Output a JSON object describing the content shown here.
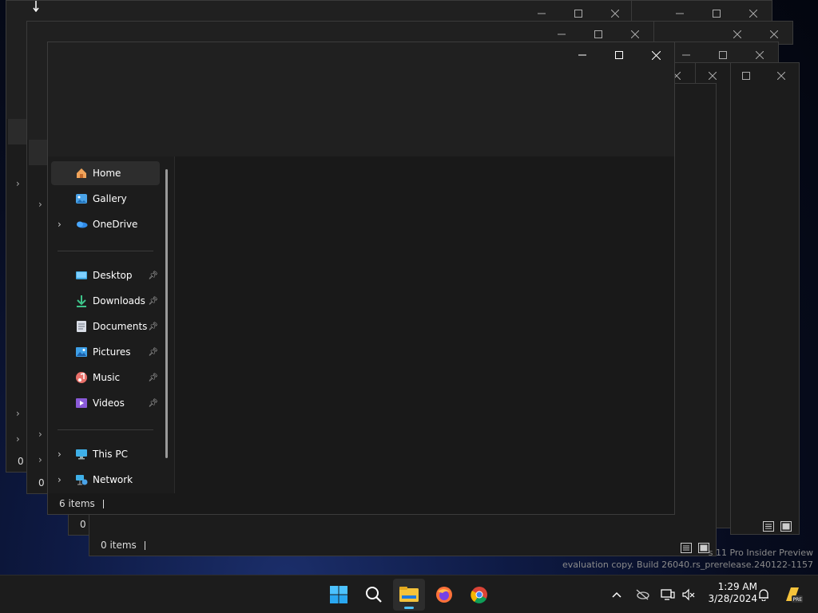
{
  "background_windows": {
    "status_text": "0 items"
  },
  "main_window": {
    "nav_items": [
      {
        "label": "Home",
        "icon": "home-icon",
        "selected": true,
        "expandable": false
      },
      {
        "label": "Gallery",
        "icon": "gallery-icon",
        "expandable": false
      },
      {
        "label": "OneDrive",
        "icon": "onedrive-icon",
        "expandable": true
      }
    ],
    "quick_access": [
      {
        "label": "Desktop",
        "icon": "desktop-folder-icon",
        "pinned": true
      },
      {
        "label": "Downloads",
        "icon": "downloads-icon",
        "pinned": true
      },
      {
        "label": "Documents",
        "icon": "documents-icon",
        "pinned": true
      },
      {
        "label": "Pictures",
        "icon": "pictures-icon",
        "pinned": true
      },
      {
        "label": "Music",
        "icon": "music-icon",
        "pinned": true
      },
      {
        "label": "Videos",
        "icon": "videos-icon",
        "pinned": true
      }
    ],
    "devices": [
      {
        "label": "This PC",
        "icon": "this-pc-icon",
        "expandable": true
      },
      {
        "label": "Network",
        "icon": "network-icon",
        "expandable": true
      }
    ],
    "status_text": "6 items"
  },
  "watermark": {
    "line1": "s 11 Pro Insider Preview",
    "line2": "evaluation copy. Build 26040.rs_prerelease.240122-1157"
  },
  "taskbar": {
    "apps": [
      "start-icon",
      "search-icon",
      "file-explorer-icon",
      "firefox-icon",
      "chrome-icon"
    ],
    "active_app": "file-explorer-icon",
    "tray": [
      "chevron-up-icon",
      "onedrive-offline-icon",
      "display-icon",
      "volume-muted-icon",
      "notification-bell-icon",
      "copilot-pre-icon"
    ]
  },
  "clock": {
    "time": "1:29 AM",
    "date": "3/28/2024"
  },
  "colors": {
    "window_bg": "#191919",
    "title_bg": "#202020",
    "selection": "#2d2d2d",
    "accent": "#4cc2ff"
  }
}
